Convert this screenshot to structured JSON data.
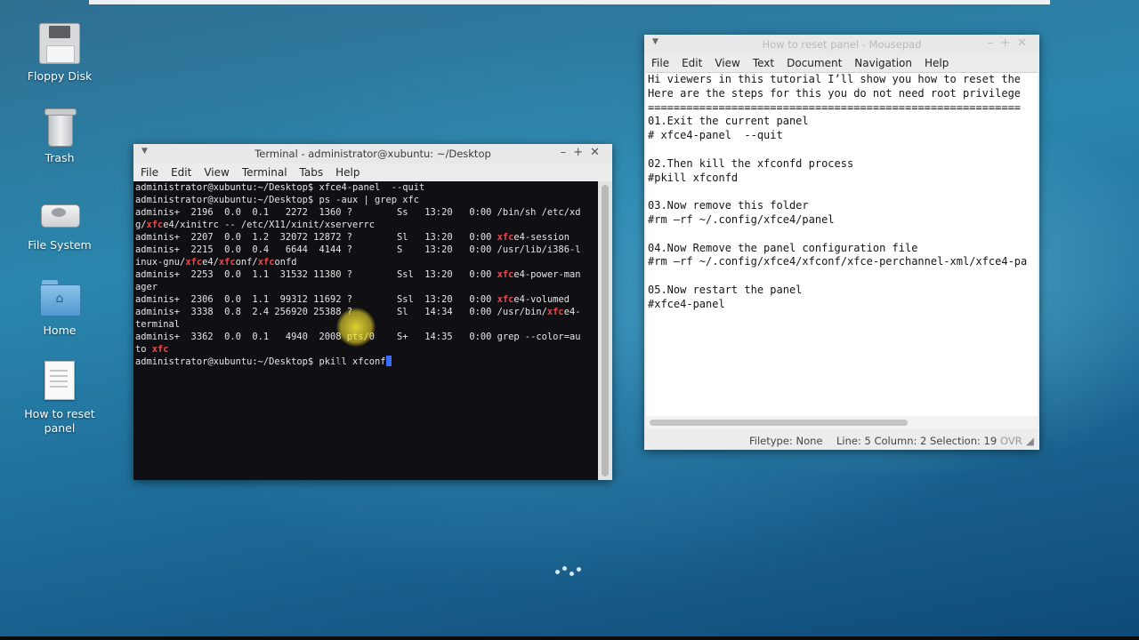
{
  "desktop": {
    "icons": [
      {
        "label": "Floppy Disk",
        "icon": "floppy-disk-icon"
      },
      {
        "label": "Trash",
        "icon": "trash-icon"
      },
      {
        "label": "File System",
        "icon": "drive-icon"
      },
      {
        "label": "Home",
        "icon": "home-folder-icon"
      },
      {
        "label": "How to reset panel",
        "icon": "text-document-icon"
      }
    ]
  },
  "terminal": {
    "title": "Terminal - administrator@xubuntu: ~/Desktop",
    "menu": [
      "File",
      "Edit",
      "View",
      "Terminal",
      "Tabs",
      "Help"
    ],
    "lines": [
      [
        {
          "t": "administrator@xubuntu:~/Desktop$ xfce4-panel  --quit"
        }
      ],
      [
        {
          "t": "administrator@xubuntu:~/Desktop$ ps -aux | grep xfc"
        }
      ],
      [
        {
          "t": "adminis+  2196  0.0  0.1   2272  1360 ?        Ss   13:20   0:00 /bin/sh /etc/xd"
        }
      ],
      [
        {
          "t": "g/"
        },
        {
          "t": "xfc",
          "r": true
        },
        {
          "t": "e4/xinitrc -- /etc/X11/xinit/xserverrc"
        }
      ],
      [
        {
          "t": "adminis+  2207  0.0  1.2  32072 12872 ?        Sl   13:20   0:00 "
        },
        {
          "t": "xfc",
          "r": true
        },
        {
          "t": "e4-session"
        }
      ],
      [
        {
          "t": "adminis+  2215  0.0  0.4   6644  4144 ?        S    13:20   0:00 /usr/lib/i386-l"
        }
      ],
      [
        {
          "t": "inux-gnu/"
        },
        {
          "t": "xfc",
          "r": true
        },
        {
          "t": "e4/"
        },
        {
          "t": "xfc",
          "r": true
        },
        {
          "t": "onf/"
        },
        {
          "t": "xfc",
          "r": true
        },
        {
          "t": "onfd"
        }
      ],
      [
        {
          "t": "adminis+  2253  0.0  1.1  31532 11380 ?        Ssl  13:20   0:00 "
        },
        {
          "t": "xfc",
          "r": true
        },
        {
          "t": "e4-power-man"
        }
      ],
      [
        {
          "t": "ager"
        }
      ],
      [
        {
          "t": "adminis+  2306  0.0  1.1  99312 11692 ?        Ssl  13:20   0:00 "
        },
        {
          "t": "xfc",
          "r": true
        },
        {
          "t": "e4-volumed"
        }
      ],
      [
        {
          "t": "adminis+  3338  0.8  2.4 256920 25388 ?        Sl   14:34   0:00 /usr/bin/"
        },
        {
          "t": "xfc",
          "r": true
        },
        {
          "t": "e4-"
        }
      ],
      [
        {
          "t": "terminal"
        }
      ],
      [
        {
          "t": "adminis+  3362  0.0  0.1   4940  2008 pts/0    S+   14:35   0:00 grep --color=au"
        }
      ],
      [
        {
          "t": "to "
        },
        {
          "t": "xfc",
          "r": true
        }
      ],
      [
        {
          "t": "administrator@xubuntu:~/Desktop$ pkill xfconf"
        },
        {
          "cursor": true
        }
      ]
    ]
  },
  "mousepad": {
    "title": "How to reset panel - Mousepad",
    "menu": [
      "File",
      "Edit",
      "View",
      "Text",
      "Document",
      "Navigation",
      "Help"
    ],
    "lines": [
      "Hi viewers in this tutorial I’ll show you how to reset the",
      "Here are the steps for this you do not need root privilege",
      "==========================================================",
      "01.Exit the current panel",
      "# xfce4-panel  --quit",
      "",
      "02.Then kill the xfconfd process",
      "#pkill xfconfd",
      "",
      "03.Now remove this folder",
      "#rm –rf ~/.config/xfce4/panel",
      "",
      "04.Now Remove the panel configuration file",
      "#rm –rf ~/.config/xfce4/xfconf/xfce-perchannel-xml/xfce4-pa",
      "",
      "05.Now restart the panel",
      "#xfce4-panel"
    ],
    "status": {
      "filetype": "Filetype: None",
      "position": "Line: 5 Column: 2 Selection: 19",
      "mode": "OVR"
    }
  },
  "colors": {
    "terminal_bg": "#0f0f14",
    "terminal_text": "#e6e6e6",
    "match_highlight": "#e84b4b",
    "cursor": "#3d6bff",
    "mouse_highlight": "#f0dc28"
  }
}
